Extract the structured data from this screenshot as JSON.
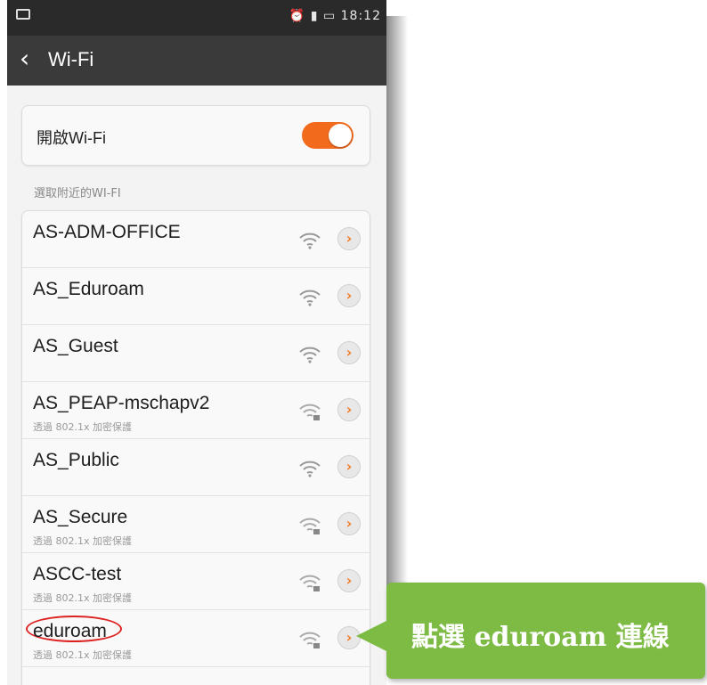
{
  "statusbar": {
    "icons": "alarm-icon signal-icon battery-icon",
    "time": "18:12"
  },
  "navbar": {
    "title": "Wi-Fi"
  },
  "wifi_toggle": {
    "label": "開啟Wi-Fi",
    "state": "on"
  },
  "section_header": "選取附近的WI-FI",
  "networks": [
    {
      "ssid": "AS-ADM-OFFICE",
      "security": ""
    },
    {
      "ssid": "AS_Eduroam",
      "security": ""
    },
    {
      "ssid": "AS_Guest",
      "security": ""
    },
    {
      "ssid": "AS_PEAP-mschapv2",
      "security": "透過 802.1x 加密保護"
    },
    {
      "ssid": "AS_Public",
      "security": ""
    },
    {
      "ssid": "AS_Secure",
      "security": "透過 802.1x 加密保護"
    },
    {
      "ssid": "ASCC-test",
      "security": "透過 802.1x 加密保護"
    },
    {
      "ssid": "eduroam",
      "security": "透過 802.1x 加密保護"
    }
  ],
  "callout": {
    "text": "點選 eduroam 連線"
  },
  "colors": {
    "accent": "#f26b1d",
    "callout": "#7dbb45",
    "highlight": "#dd2222"
  }
}
